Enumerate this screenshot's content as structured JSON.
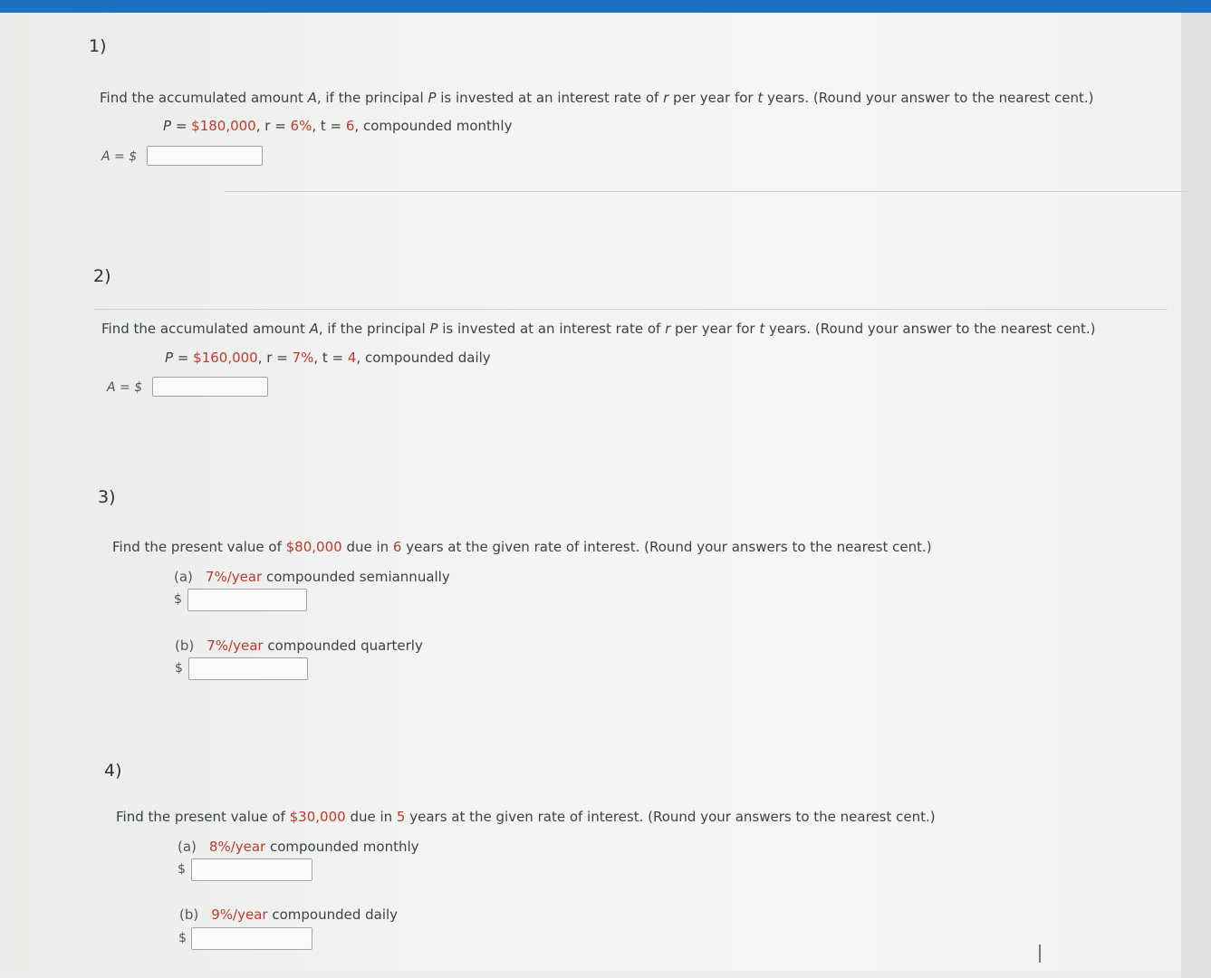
{
  "q1": {
    "number": "1)",
    "prompt_a": "Find the accumulated amount ",
    "var_A": "A",
    "prompt_b": ", if the principal ",
    "var_P": "P",
    "prompt_c": " is invested at an interest rate of ",
    "var_r": "r",
    "prompt_d": " per year for ",
    "var_t": "t",
    "prompt_e": " years. (Round your answer to the nearest cent.)",
    "given_p_label": "P = ",
    "given_p": "$180,000",
    "given_r_label": ", r = ",
    "given_r": "6%",
    "given_t_label": ", t = ",
    "given_t": "6",
    "given_comp": ",  compounded monthly",
    "answer_label": "A = $",
    "answer_value": ""
  },
  "q2": {
    "number": "2)",
    "prompt_a": "Find the accumulated amount ",
    "var_A": "A",
    "prompt_b": ", if the principal ",
    "var_P": "P",
    "prompt_c": " is invested at an interest rate of ",
    "var_r": "r",
    "prompt_d": " per year for ",
    "var_t": "t",
    "prompt_e": " years. (Round your answer to the nearest cent.)",
    "given_p_label": "P = ",
    "given_p": "$160,000",
    "given_r_label": ", r = ",
    "given_r": "7%",
    "given_t_label": ", t = ",
    "given_t": "4",
    "given_comp": ", compounded daily",
    "answer_label": "A = $",
    "answer_value": ""
  },
  "q3": {
    "number": "3)",
    "prompt_a": "Find the present value of ",
    "amount": "$80,000",
    "prompt_b": " due in ",
    "years": "6",
    "prompt_c": " years at the given rate of interest. (Round your answers to the nearest cent.)",
    "parts": [
      {
        "letter": "(a)",
        "rate": "7%/year",
        "comp": " compounded semiannually",
        "dollar": "$",
        "value": ""
      },
      {
        "letter": "(b)",
        "rate": "7%/year",
        "comp": " compounded quarterly",
        "dollar": "$",
        "value": ""
      }
    ]
  },
  "q4": {
    "number": "4)",
    "prompt_a": "Find the present value of ",
    "amount": "$30,000",
    "prompt_b": " due in ",
    "years": "5",
    "prompt_c": " years at the given rate of interest. (Round your answers to the nearest cent.)",
    "parts": [
      {
        "letter": "(a)",
        "rate": "8%/year",
        "comp": " compounded monthly",
        "dollar": "$",
        "value": ""
      },
      {
        "letter": "(b)",
        "rate": "9%/year",
        "comp": " compounded daily",
        "dollar": "$",
        "value": ""
      }
    ]
  },
  "colors": {
    "accent": "#1f6fc4",
    "highlight": "#c0392b"
  }
}
